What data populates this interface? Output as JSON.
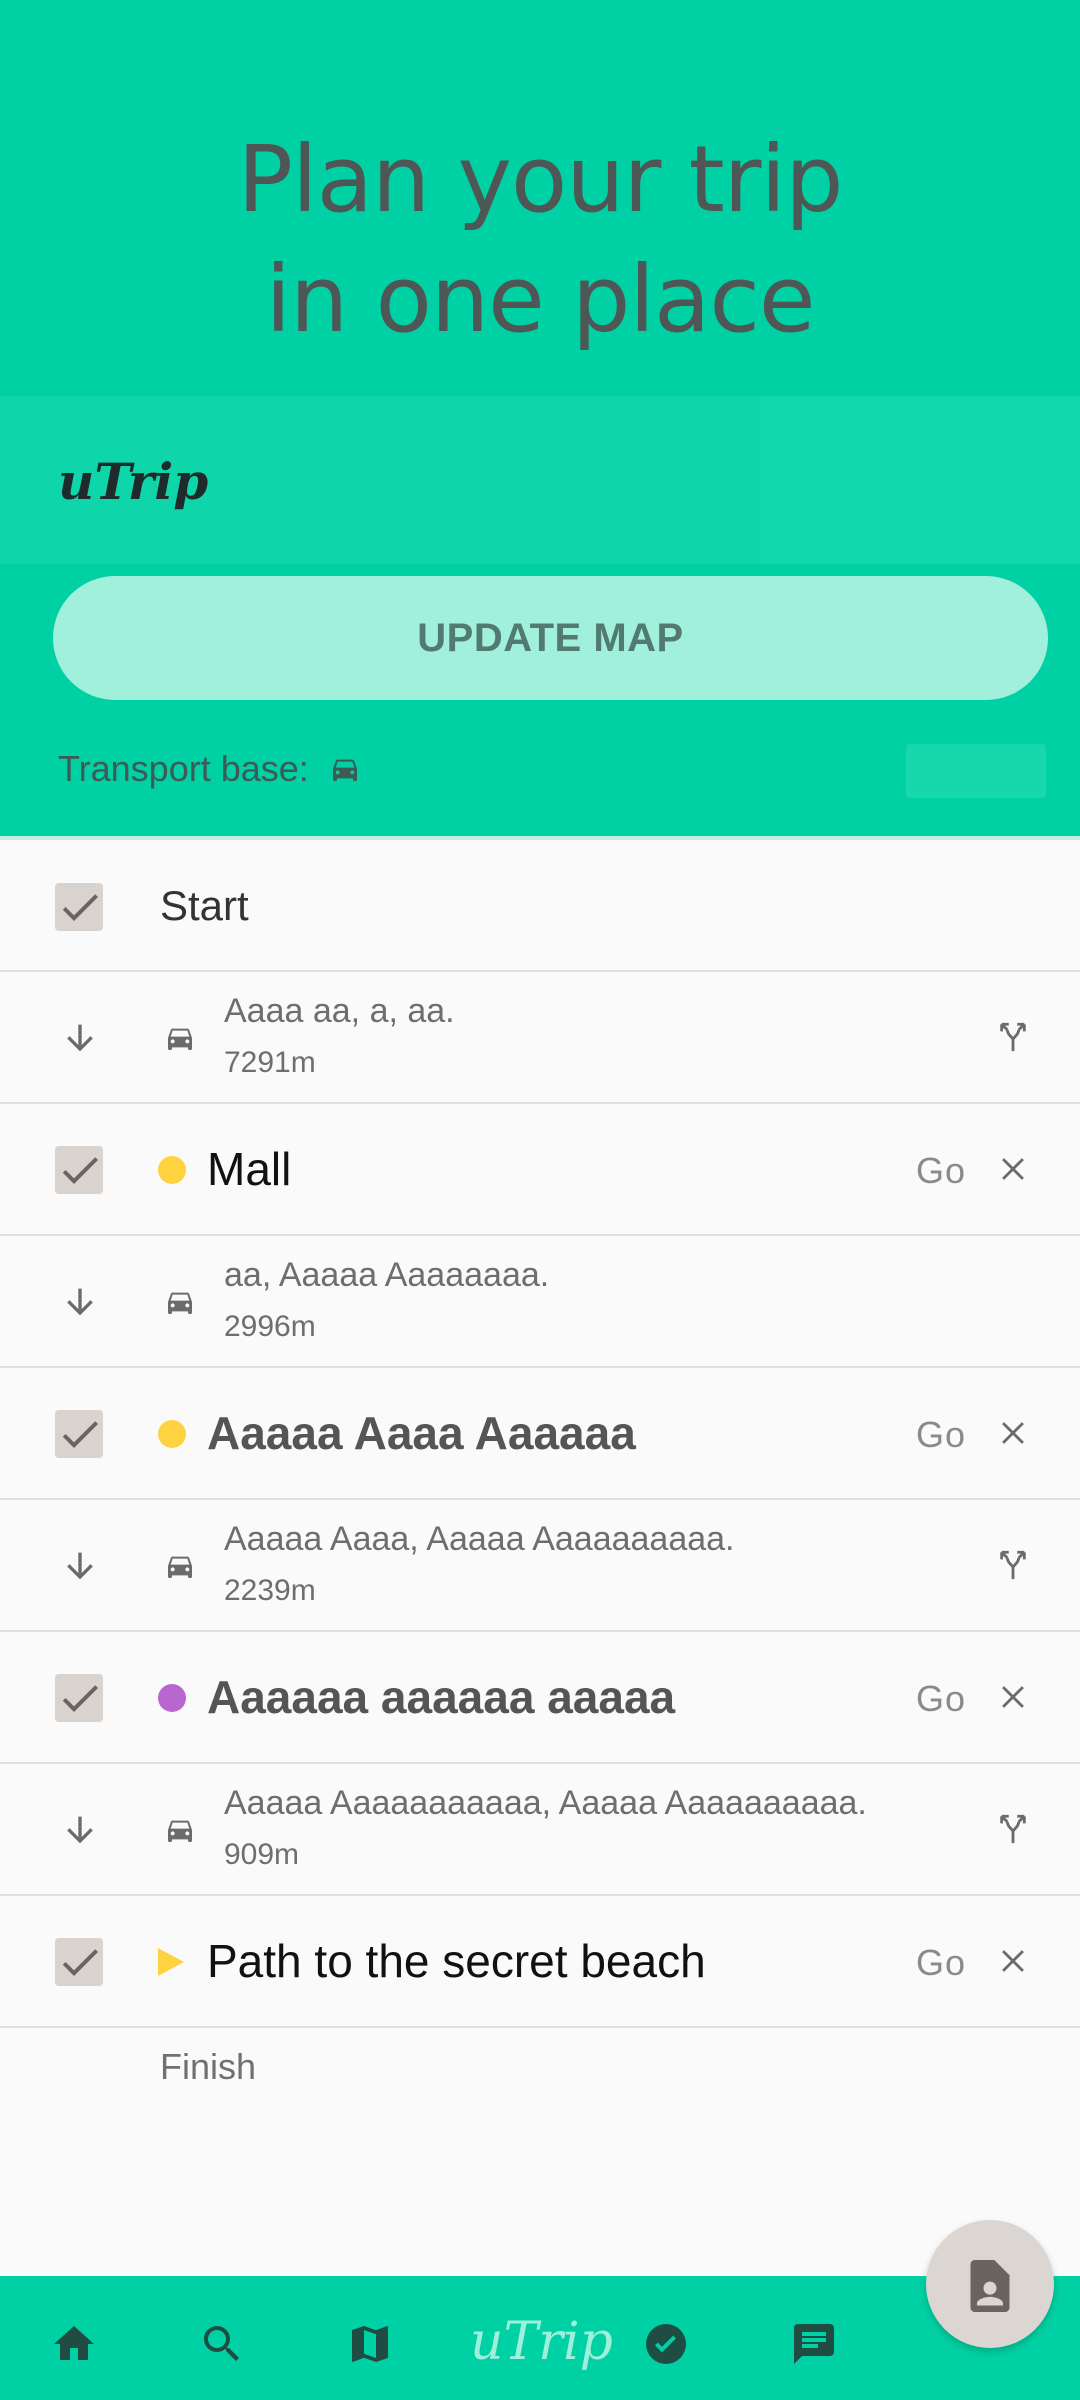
{
  "hero": {
    "title_line1": "Plan your trip",
    "title_line2": "in one place"
  },
  "brand": {
    "logo": "uTrip"
  },
  "controls": {
    "update_button": "UPDATE MAP",
    "transport_label": "Transport base:",
    "transport_icon": "car-icon"
  },
  "list": {
    "start_label": "Start",
    "finish_label": "Finish",
    "go_label": "Go",
    "places": [
      {
        "name": "Mall",
        "marker": "dot",
        "color": "#ffd23f"
      },
      {
        "name": "Aaaaa Aaaa Aaaaaa",
        "marker": "dot",
        "color": "#ffd23f"
      },
      {
        "name": "Aaaaaa aaaaaa aaaaa",
        "marker": "dot",
        "color": "#b866d0"
      },
      {
        "name": "Path to the secret beach",
        "marker": "triangle",
        "color": "#ffd23f"
      }
    ],
    "segments": [
      {
        "description": "Aaaa aa, a, aa.",
        "distance": "7291m",
        "has_alternatives": true
      },
      {
        "description": "aa, Aaaaa Aaaaaaaa.",
        "distance": "2996m",
        "has_alternatives": false
      },
      {
        "description": "Aaaaa Aaaa, Aaaaa Aaaaaaaaaa.",
        "distance": "2239m",
        "has_alternatives": true
      },
      {
        "description": "Aaaaa Aaaaaaaaaaa, Aaaaa Aaaaaaaaaa.",
        "distance": "909m",
        "has_alternatives": true
      }
    ]
  },
  "bottom_nav": {
    "logo": "uTrip",
    "items": [
      "home-icon",
      "search-icon",
      "map-icon",
      "checklist-icon",
      "chat-icon"
    ]
  },
  "colors": {
    "accent": "#00d1a4",
    "button_bg": "#a0f0dc",
    "yellow": "#ffd23f",
    "purple": "#b866d0"
  }
}
